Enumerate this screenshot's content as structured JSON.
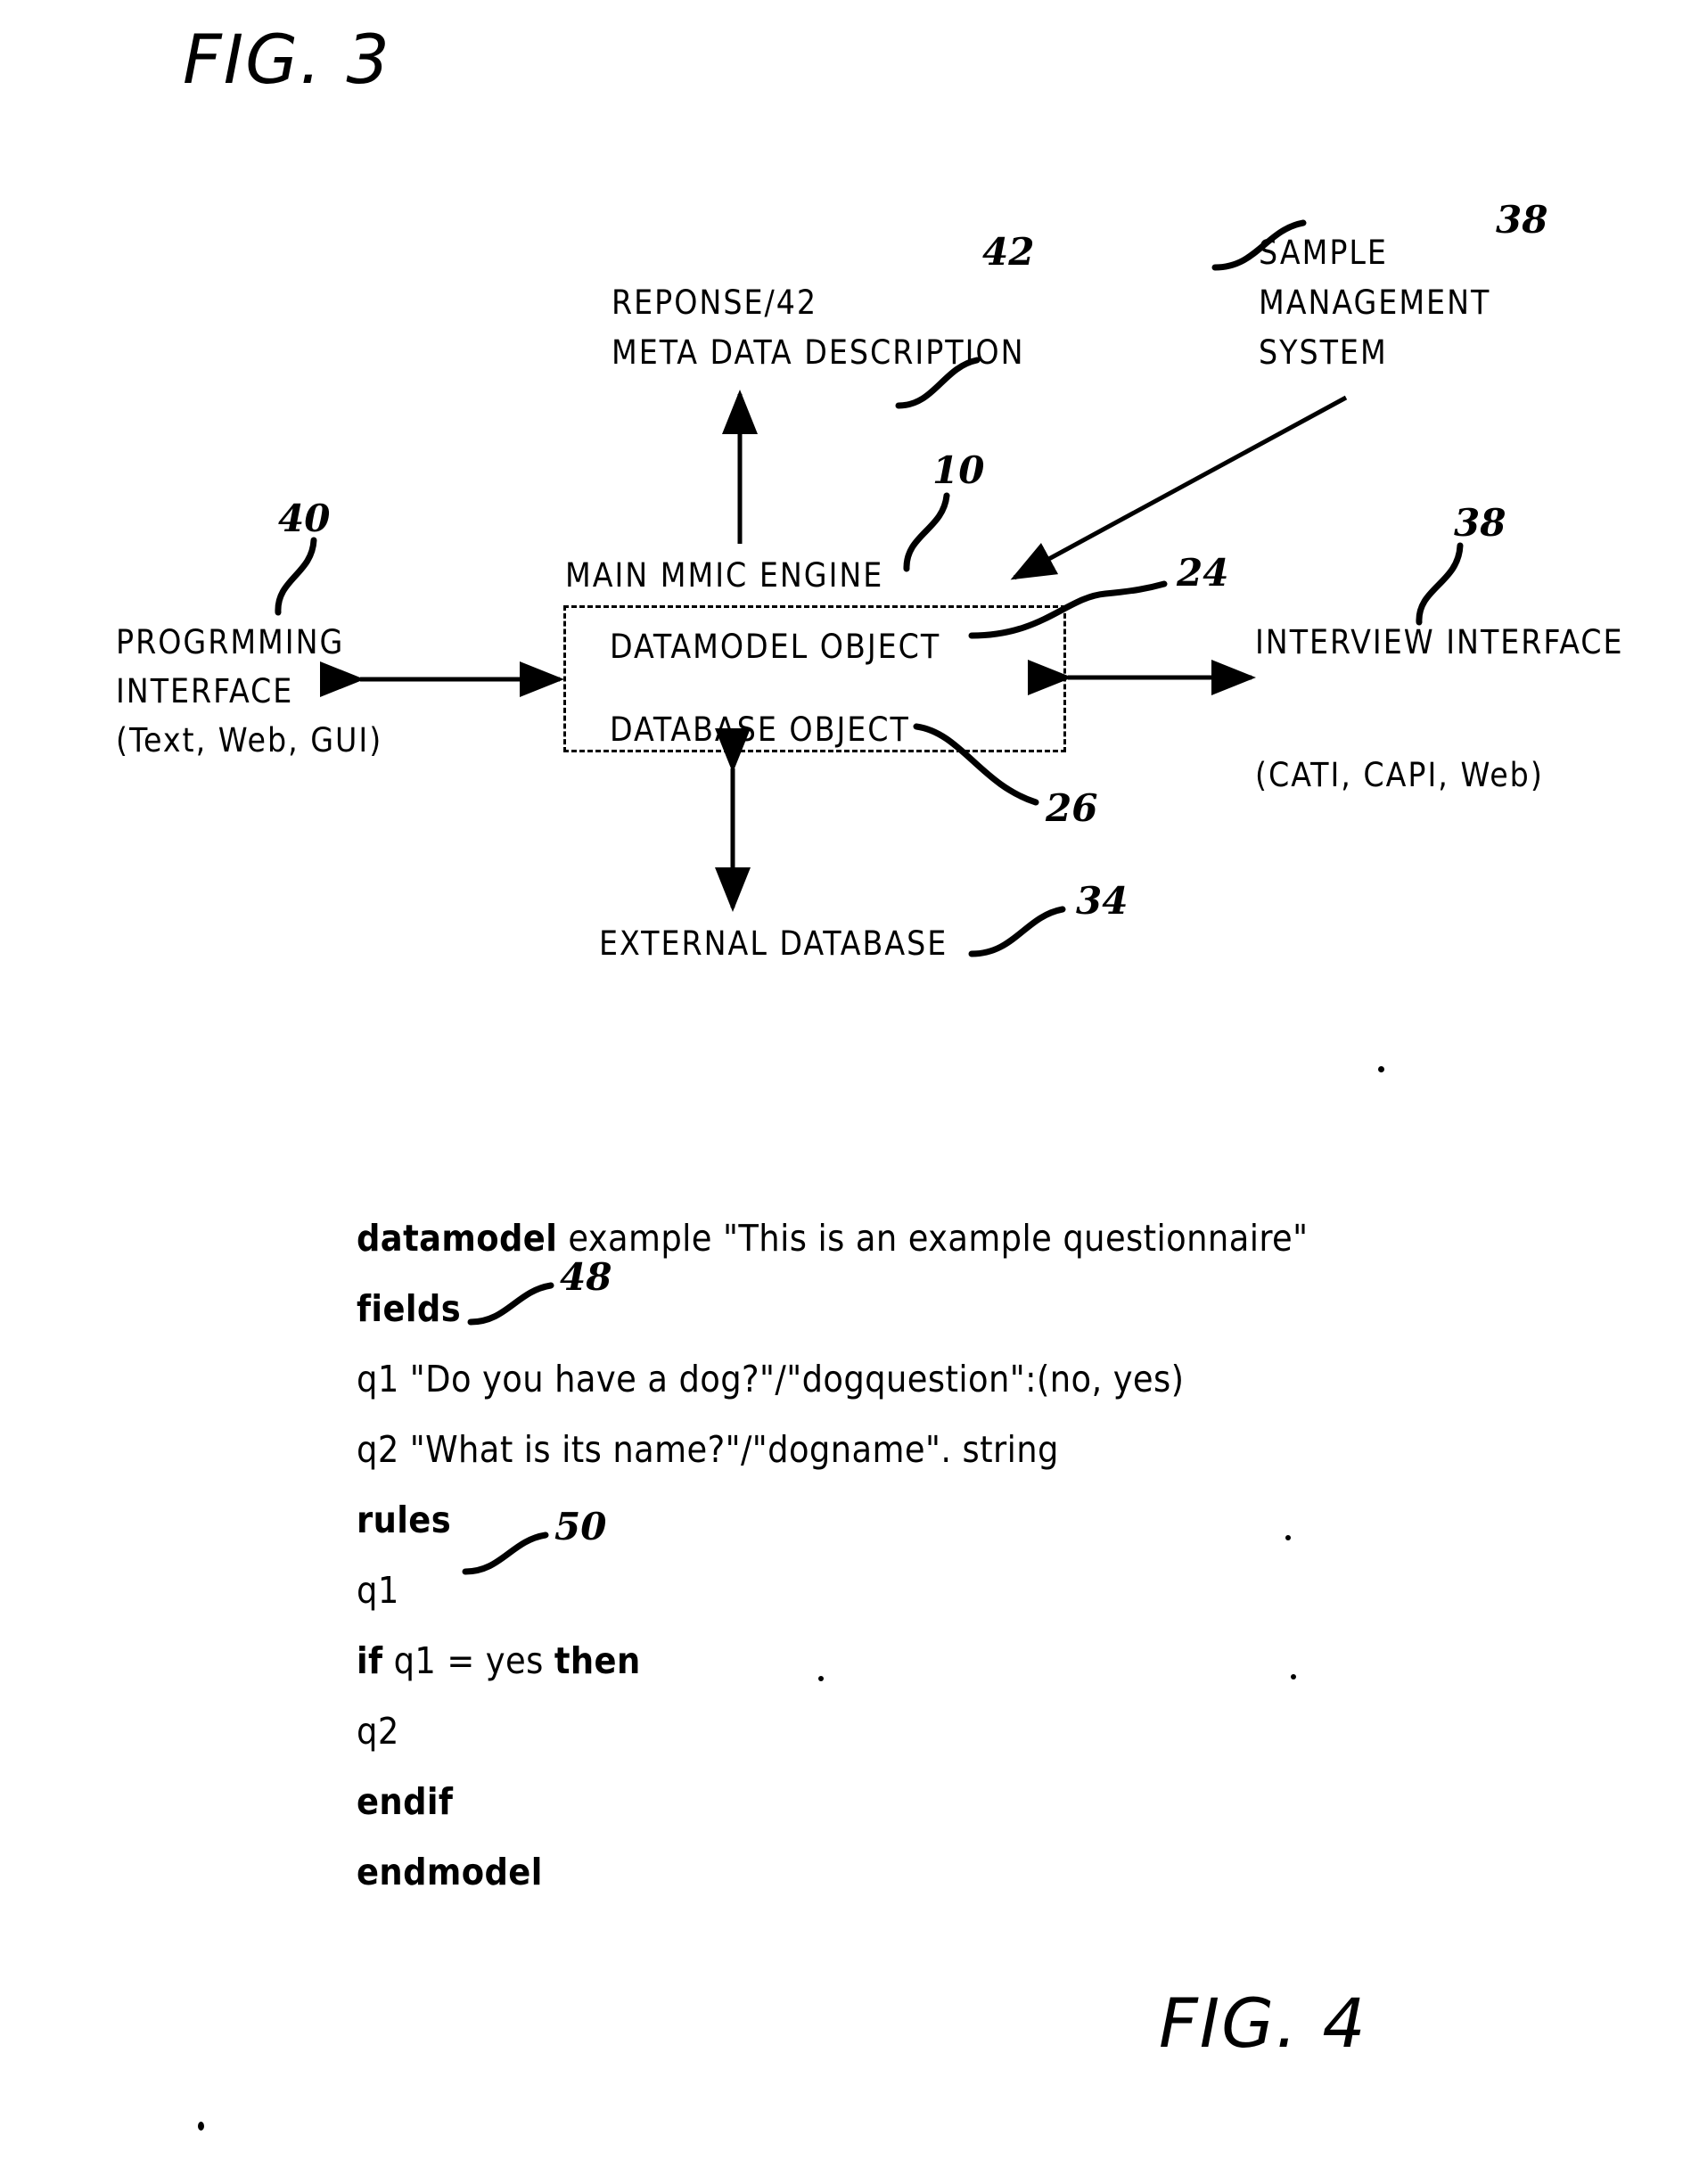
{
  "figures": {
    "fig3": {
      "title": "FIG. 3",
      "nodes": {
        "response_meta": {
          "line1": "REPONSE/42",
          "line2": "META DATA DESCRIPTION",
          "ref": "42"
        },
        "sample_management": {
          "line1": "SAMPLE",
          "line2": "MANAGEMENT",
          "line3": "SYSTEM",
          "ref": "38"
        },
        "main_engine": {
          "label": "MAIN MMIC ENGINE",
          "ref": "10",
          "children": [
            {
              "label": "DATAMODEL OBJECT",
              "ref": "24"
            },
            {
              "label": "DATABASE OBJECT",
              "ref": "26"
            }
          ]
        },
        "programming_interface": {
          "line1": "PROGRMMING",
          "line2": "INTERFACE",
          "line3": "(Text, Web, GUI)",
          "ref": "40"
        },
        "interview_interface": {
          "line1": "INTERVIEW INTERFACE",
          "line2": "(CATI, CAPI, Web)",
          "ref": "38"
        },
        "external_database": {
          "label": "EXTERNAL DATABASE",
          "ref": "34"
        }
      }
    },
    "fig4": {
      "title": "FIG. 4",
      "code_lines": [
        {
          "segments": [
            {
              "text": "datamodel",
              "bold": true
            },
            {
              "text": " example \"This is an example questionnaire\"",
              "bold": false
            }
          ],
          "ref": ""
        },
        {
          "segments": [
            {
              "text": "fields",
              "bold": true
            }
          ],
          "ref": "48"
        },
        {
          "segments": [
            {
              "text": "q1 \"Do you have a dog?\"/\"dogquestion\":(no, yes)",
              "bold": false
            }
          ],
          "ref": ""
        },
        {
          "segments": [
            {
              "text": "q2 \"What is its name?\"/\"dogname\". string",
              "bold": false
            }
          ],
          "ref": ""
        },
        {
          "segments": [
            {
              "text": "rules",
              "bold": true
            }
          ],
          "ref": "50"
        },
        {
          "segments": [
            {
              "text": "q1",
              "bold": false
            }
          ],
          "ref": ""
        },
        {
          "segments": [
            {
              "text": "if",
              "bold": true
            },
            {
              "text": " q1 = yes ",
              "bold": false
            },
            {
              "text": "then",
              "bold": true
            }
          ],
          "ref": ""
        },
        {
          "segments": [
            {
              "text": "q2",
              "bold": false
            }
          ],
          "ref": ""
        },
        {
          "segments": [
            {
              "text": "endif",
              "bold": true
            }
          ],
          "ref": ""
        },
        {
          "segments": [
            {
              "text": "endmodel",
              "bold": true
            }
          ],
          "ref": ""
        }
      ]
    }
  },
  "colors": {
    "ink": "#000000",
    "paper": "#ffffff"
  }
}
